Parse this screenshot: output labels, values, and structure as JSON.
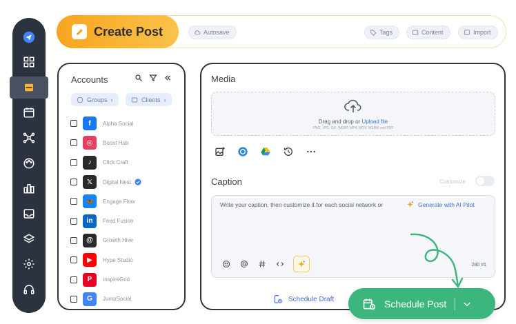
{
  "header": {
    "title": "Create Post",
    "chips": {
      "autosave": "Autosave",
      "tags": "Tags",
      "content": "Content",
      "import": "Import"
    }
  },
  "accounts": {
    "title": "Accounts",
    "filters": {
      "groups": "Groups",
      "clients": "Clients"
    },
    "items": [
      {
        "name": "Alpha Social",
        "network": "facebook",
        "color": "#1877f2",
        "glyph": "f"
      },
      {
        "name": "Boost Hub",
        "network": "instagram",
        "color": "#e4405f",
        "glyph": "◎"
      },
      {
        "name": "Click Craft",
        "network": "tiktok",
        "color": "#2a2a2a",
        "glyph": "♪"
      },
      {
        "name": "Digital Nest",
        "network": "x",
        "color": "#2a2a2a",
        "glyph": "𝕏",
        "verified": true
      },
      {
        "name": "Engage Flow",
        "network": "bluesky",
        "color": "#1185fe",
        "glyph": "🦋"
      },
      {
        "name": "Feed Fusion",
        "network": "linkedin",
        "color": "#0a66c2",
        "glyph": "in"
      },
      {
        "name": "Growth Hive",
        "network": "threads",
        "color": "#2a2a2a",
        "glyph": "@"
      },
      {
        "name": "Hype Studio",
        "network": "youtube",
        "color": "#ff0000",
        "glyph": "▶"
      },
      {
        "name": "InspireGrid",
        "network": "pinterest",
        "color": "#e60023",
        "glyph": "P"
      },
      {
        "name": "JumpSocial",
        "network": "google-business",
        "color": "#4285f4",
        "glyph": "G"
      }
    ]
  },
  "media": {
    "title": "Media",
    "drop_text": "Drag and drop or",
    "upload_link": "Upload file",
    "formats": "PNG, JPG, GIF, WEBP, MP4, MOV, WEBM and PDF"
  },
  "caption": {
    "title": "Caption",
    "customize_label": "Customize",
    "placeholder": "Write your caption, then customize it for each social network or",
    "ai_link": "Generate with AI Pilot",
    "char_count": "280 #1"
  },
  "actions": {
    "schedule_draft": "Schedule Draft",
    "schedule_post": "Schedule Post"
  },
  "colors": {
    "accent_orange": "#f7a51f",
    "accent_green": "#3db67d",
    "link_blue": "#3e6fd8",
    "sidebar_bg": "#2c3340"
  }
}
